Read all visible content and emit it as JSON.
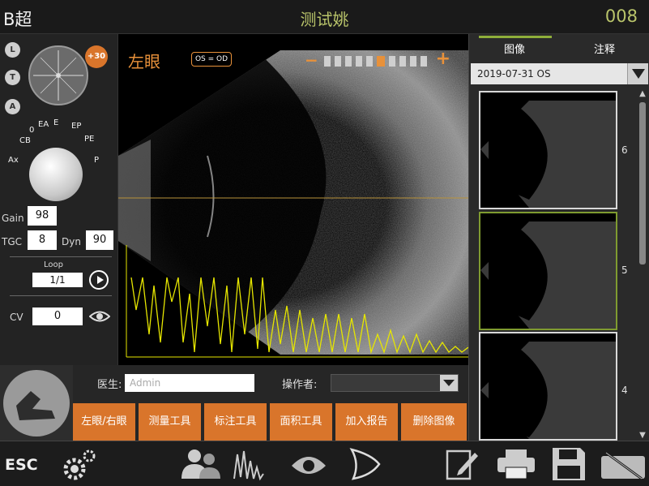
{
  "header": {
    "mode_title": "B超",
    "patient_name": "测试姚",
    "patient_id": "008"
  },
  "left_panel": {
    "view_buttons": [
      "L",
      "T",
      "A"
    ],
    "angle_badge": "+30",
    "dial_labels": [
      "0",
      "EA",
      "E",
      "EP",
      "PE",
      "CB",
      "Ax",
      "P"
    ],
    "gain_label": "Gain",
    "gain_value": "98",
    "tgc_label": "TGC",
    "tgc_value": "8",
    "dyn_label": "Dyn",
    "dyn_value": "90",
    "loop_label": "Loop",
    "loop_value": "1/1",
    "cv_label": "CV",
    "cv_value": "0"
  },
  "image_view": {
    "eye_label": "左眼",
    "os_badge": "OS = OD",
    "zoom_minus": "−",
    "zoom_plus": "+",
    "zoom_segments": 10,
    "zoom_active_index": 5
  },
  "right_panel": {
    "tabs": [
      "图像",
      "注释"
    ],
    "active_tab": "图像",
    "date_select": "2019-07-31 OS",
    "thumbnails": [
      {
        "number": "6",
        "selected": false
      },
      {
        "number": "5",
        "selected": true
      },
      {
        "number": "4",
        "selected": false
      }
    ]
  },
  "form": {
    "doctor_label": "医生:",
    "doctor_value": "Admin",
    "operator_label": "操作者:",
    "operator_value": ""
  },
  "actions": [
    "左眼/右眼",
    "测量工具",
    "标注工具",
    "面积工具",
    "加入报告",
    "删除图像"
  ],
  "toolbar": {
    "esc_label": "ESC",
    "icons": [
      "settings-icon",
      "patients-icon",
      "waveform-icon",
      "eye-scan-icon",
      "probe-icon",
      "edit-report-icon",
      "print-icon",
      "save-icon",
      "keyboard-icon"
    ]
  },
  "colors": {
    "accent_orange": "#d9752b",
    "title_green": "#b9c46a",
    "selected_green": "#7f9b30",
    "waveform_yellow": "#e6e600",
    "guide_line": "#b8923a"
  }
}
